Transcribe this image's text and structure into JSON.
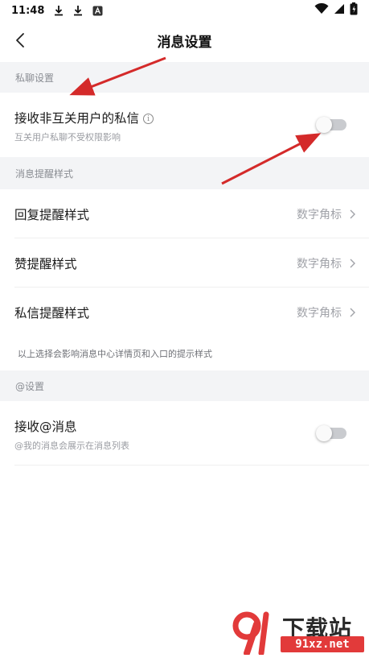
{
  "status_bar": {
    "time": "11:48"
  },
  "nav": {
    "title": "消息设置"
  },
  "sections": {
    "private_chat": {
      "header": "私聊设置",
      "item_label": "接收非互关用户的私信",
      "item_sub": "互关用户私聊不受权限影响",
      "toggle_on": false
    },
    "reminder_style": {
      "header": "消息提醒样式",
      "items": [
        {
          "label": "回复提醒样式",
          "value": "数字角标"
        },
        {
          "label": "赞提醒样式",
          "value": "数字角标"
        },
        {
          "label": "私信提醒样式",
          "value": "数字角标"
        }
      ],
      "note": "以上选择会影响消息中心详情页和入口的提示样式"
    },
    "at_settings": {
      "header": "@设置",
      "item_label": "接收@消息",
      "item_sub": "@我的消息会展示在消息列表",
      "toggle_on": false
    }
  },
  "watermark": {
    "brand": "下载站",
    "url": "91xz.net"
  },
  "colors": {
    "section_bg": "#f3f4f6",
    "arrow": "#d42a2a",
    "toggle_track": "#c9cbcf"
  }
}
